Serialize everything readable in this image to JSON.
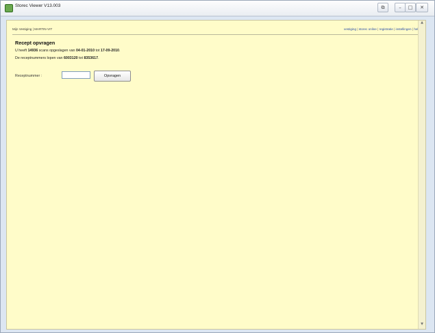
{
  "window": {
    "title": "Storec Viewer V13.003",
    "buttons": {
      "extra": "⧉",
      "minimize": "–",
      "maximize": "□",
      "close": "✕"
    }
  },
  "topnav": {
    "left": "Mijn Vestiging | MARTIN-VIT",
    "right": [
      "vestiging",
      "storec online",
      "registratie",
      "instellingen",
      "help"
    ]
  },
  "main": {
    "heading": "Recept opvragen",
    "line1": {
      "p1": "U heeft ",
      "count": "14936",
      "p2": " scans opgeslagen van ",
      "from_date": "04-01-2010",
      "p3": " tot ",
      "to_date": "17-09-2010",
      "p4": "."
    },
    "line2": {
      "p1": "De receptnummers lopen van ",
      "from_nr": "6003120",
      "p2": " tot ",
      "to_nr": "8353617",
      "p3": "."
    },
    "form": {
      "label": "Receptnummer :",
      "value": "",
      "button": "Opvragen"
    }
  }
}
